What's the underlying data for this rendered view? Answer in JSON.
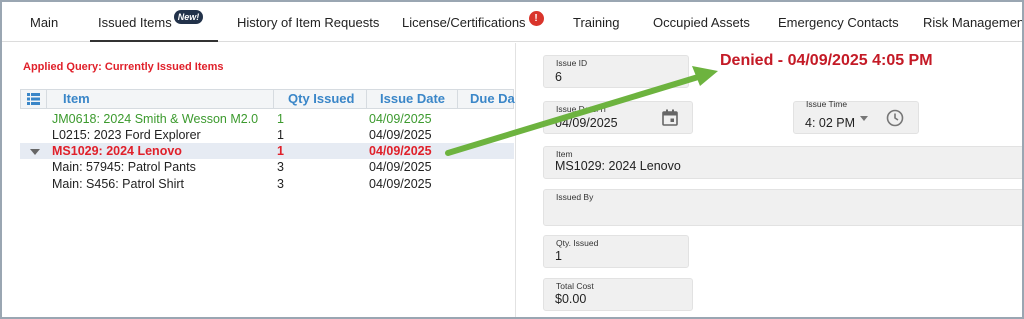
{
  "tabs": [
    {
      "label": "Main"
    },
    {
      "label": "Issued Items",
      "badge": "New!"
    },
    {
      "label": "History of Item Requests"
    },
    {
      "label": "License/Certifications",
      "badge": "!"
    },
    {
      "label": "Training"
    },
    {
      "label": "Occupied Assets"
    },
    {
      "label": "Emergency Contacts"
    },
    {
      "label": "Risk Management"
    }
  ],
  "active_tab": "Issued Items",
  "applied_query": "Applied Query: Currently Issued Items",
  "grid": {
    "columns": [
      "Item",
      "Qty Issued",
      "Issue Date",
      "Due Da"
    ],
    "rows": [
      {
        "item": "JM0618: 2024 Smith & Wesson M2.0",
        "qty": "1",
        "date": "04/09/2025",
        "style": "green"
      },
      {
        "item": "L0215: 2023 Ford Explorer",
        "qty": "1",
        "date": "04/09/2025",
        "style": "plain"
      },
      {
        "item": "MS1029: 2024 Lenovo",
        "qty": "1",
        "date": "04/09/2025",
        "style": "red",
        "selected": true
      },
      {
        "item": "Main: 57945: Patrol Pants",
        "qty": "3",
        "date": "04/09/2025",
        "style": "plain"
      },
      {
        "item": "Main: S456: Patrol Shirt",
        "qty": "3",
        "date": "04/09/2025",
        "style": "plain"
      }
    ]
  },
  "form": {
    "issue_id": {
      "label": "Issue ID",
      "value": "6"
    },
    "issue_date": {
      "label": "Issue Date/Ti",
      "value": "04/09/2025"
    },
    "issue_time": {
      "label": "Issue Time",
      "value": "4: 02 PM"
    },
    "item": {
      "label": "Item",
      "value": "MS1029: 2024 Lenovo"
    },
    "issued_by": {
      "label": "Issued By",
      "value": ""
    },
    "qty_issued": {
      "label": "Qty. Issued",
      "value": "1"
    },
    "total_cost": {
      "label": "Total Cost",
      "value": "$0.00"
    }
  },
  "annotation": {
    "text": "Denied - 04/09/2025 4:05 PM",
    "color": "#c41a26",
    "arrow_color": "#6db33f"
  },
  "icons": [
    "list-icon",
    "calendar-icon",
    "clock-icon",
    "expand-caret-icon",
    "dropdown-caret-icon"
  ]
}
